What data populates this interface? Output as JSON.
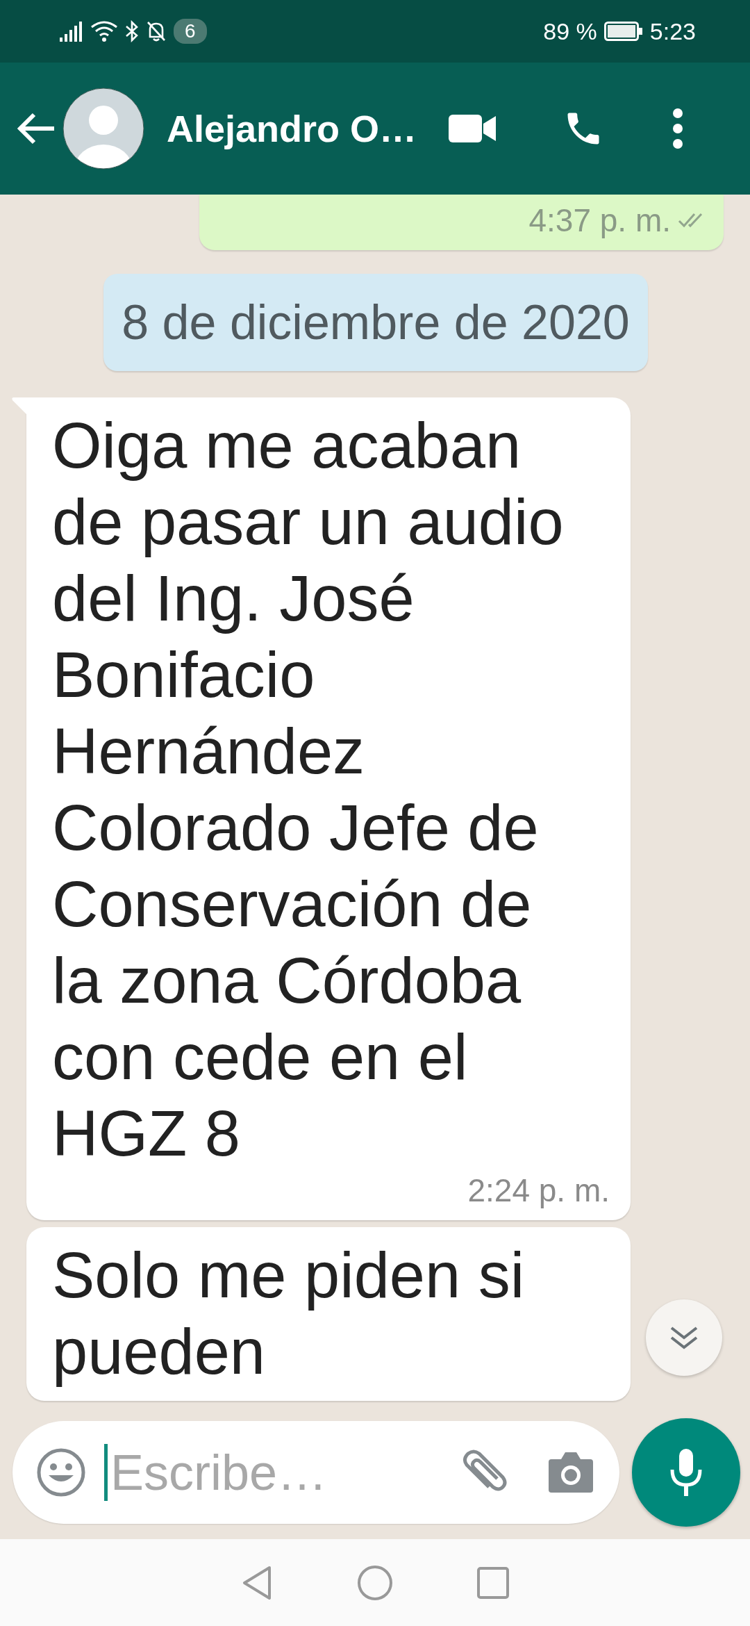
{
  "status_bar": {
    "notification_count": "6",
    "battery": "89 %",
    "time": "5:23"
  },
  "header": {
    "contact_name": "Alejandro O…"
  },
  "messages": [
    {
      "kind": "outgoing",
      "time": "4:37 p. m.",
      "read": false
    },
    {
      "kind": "date",
      "text": "8 de diciembre de 2020"
    },
    {
      "kind": "incoming",
      "text": "Oiga me acaban de pasar un audio del Ing. José Bonifacio Hernández Colorado Jefe de Conservación de la zona Córdoba con cede en el HGZ 8",
      "time": "2:24 p. m.",
      "tail": true
    },
    {
      "kind": "incoming",
      "text": "Solo me piden si pueden",
      "tail": false
    }
  ],
  "composer": {
    "placeholder": "Escribe…"
  }
}
